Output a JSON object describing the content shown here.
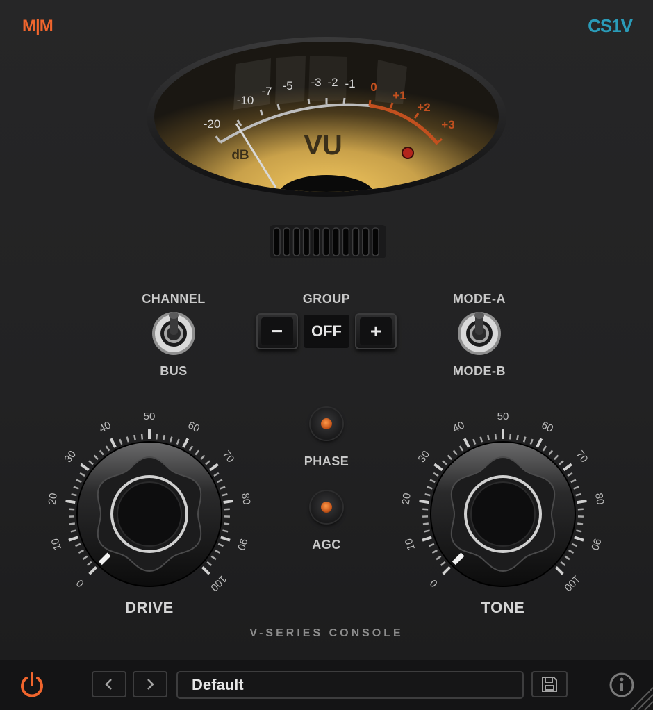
{
  "header": {
    "brand": "M|M",
    "product": "CS1V"
  },
  "meter": {
    "title": "VU",
    "unit": "dB",
    "scale_black": [
      "-20",
      "-10",
      "-7",
      "-5",
      "-3",
      "-2",
      "-1"
    ],
    "scale_red": [
      "0",
      "+1",
      "+2",
      "+3"
    ]
  },
  "switches": {
    "channel": {
      "top_label": "CHANNEL",
      "bottom_label": "BUS"
    },
    "mode": {
      "top_label": "MODE-A",
      "bottom_label": "MODE-B"
    }
  },
  "group": {
    "label": "GROUP",
    "minus": "−",
    "value": "OFF",
    "plus": "+"
  },
  "buttons": {
    "phase": "PHASE",
    "agc": "AGC"
  },
  "knobs": {
    "scale": [
      "0",
      "10",
      "20",
      "30",
      "40",
      "50",
      "60",
      "70",
      "80",
      "90",
      "100"
    ],
    "drive": {
      "label": "DRIVE",
      "value": 0
    },
    "tone": {
      "label": "TONE",
      "value": 0
    }
  },
  "footer_text": "V-SERIES CONSOLE",
  "footer": {
    "preset": "Default"
  },
  "colors": {
    "accent": "#f0652d",
    "product": "#2a9bb8",
    "meter_red": "#c2501f"
  }
}
